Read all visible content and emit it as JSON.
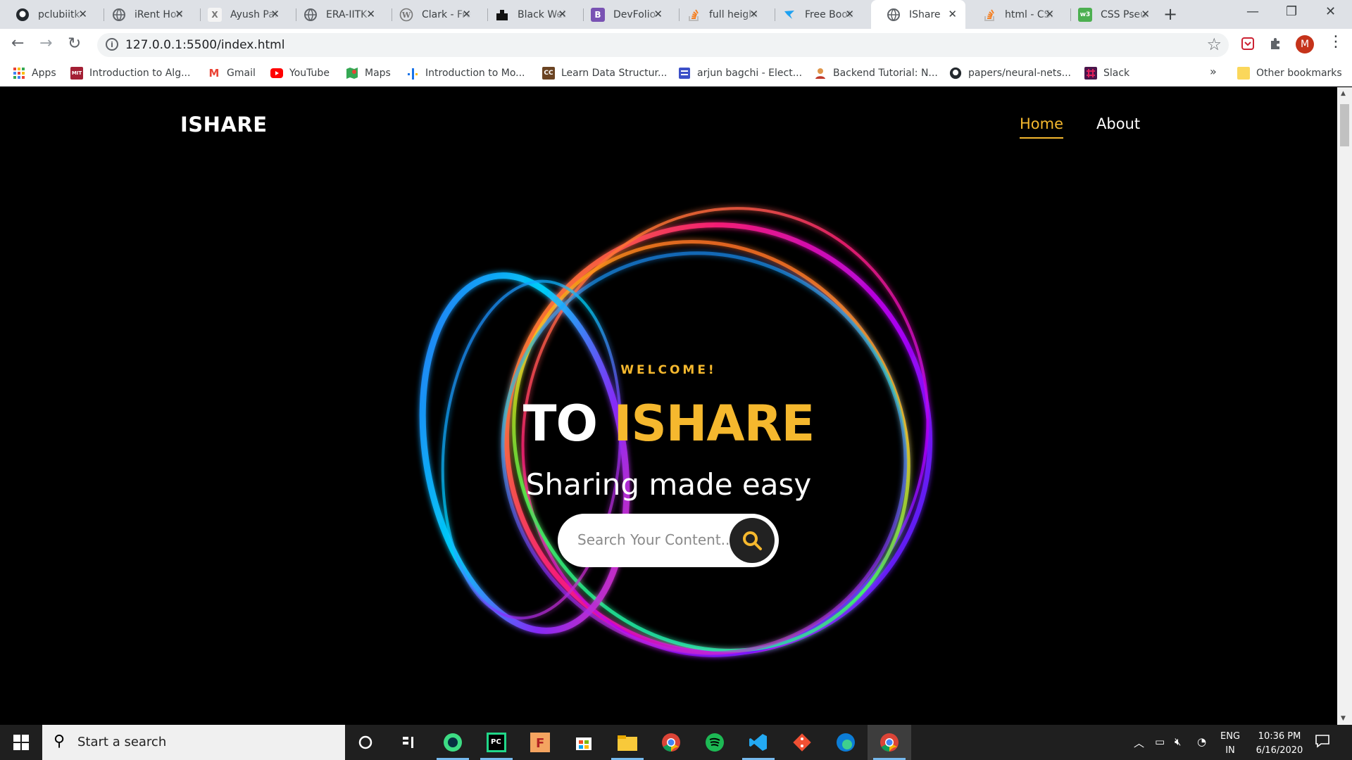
{
  "browser": {
    "tabs": [
      {
        "title": "pclubiitk",
        "icon": "github-icon",
        "active": false
      },
      {
        "title": "iRent Home",
        "icon": "globe-icon",
        "active": false
      },
      {
        "title": "Ayush Pal",
        "icon": "x-logo-icon",
        "active": false
      },
      {
        "title": "ERA-IITK",
        "icon": "globe-icon",
        "active": false
      },
      {
        "title": "Clark - Free",
        "icon": "wordpress-icon",
        "active": false
      },
      {
        "title": "Black Website",
        "icon": "black-logo-icon",
        "active": false
      },
      {
        "title": "DevFolio",
        "icon": "bootstrap-icon",
        "active": false
      },
      {
        "title": "full height",
        "icon": "stackoverflow-icon",
        "active": false
      },
      {
        "title": "Free Bootstrap",
        "icon": "bird-icon",
        "active": false
      },
      {
        "title": "IShare",
        "icon": "globe-icon",
        "active": true
      },
      {
        "title": "html - CSS",
        "icon": "stackoverflow-icon",
        "active": false
      },
      {
        "title": "CSS Pseudo",
        "icon": "w3-icon",
        "active": false
      }
    ],
    "url": "127.0.0.1:5500/index.html",
    "profile_initial": "M",
    "bookmarks": [
      {
        "label": "Apps",
        "icon": "apps-grid-icon"
      },
      {
        "label": "Introduction to Alg...",
        "icon": "mit-ocw-icon"
      },
      {
        "label": "Gmail",
        "icon": "gmail-icon"
      },
      {
        "label": "YouTube",
        "icon": "youtube-icon"
      },
      {
        "label": "Maps",
        "icon": "maps-icon"
      },
      {
        "label": "Introduction to Mo...",
        "icon": "chart-icon"
      },
      {
        "label": "Learn Data Structur...",
        "icon": "cc-icon"
      },
      {
        "label": "arjun bagchi - Elect...",
        "icon": "forms-icon"
      },
      {
        "label": "Backend Tutorial: N...",
        "icon": "person-icon"
      },
      {
        "label": "papers/neural-nets...",
        "icon": "github-icon"
      },
      {
        "label": "Slack",
        "icon": "slack-icon"
      }
    ],
    "bookmarks_overflow": "»",
    "other_bookmarks": "Other bookmarks"
  },
  "page": {
    "brand": "ISHARE",
    "nav": {
      "home": "Home",
      "about": "About"
    },
    "welcome": "WELCOME!",
    "title_prefix": "TO",
    "title_accent": "ISHARE",
    "tagline": "Sharing made easy",
    "search_placeholder": "Search Your Content...",
    "accent_color": "#f5b82e"
  },
  "taskbar": {
    "search_text": "Start a search",
    "apps": [
      "cortana-icon",
      "task-view-icon",
      "android-studio-icon",
      "pycharm-icon",
      "filezilla-icon",
      "store-icon",
      "file-explorer-icon",
      "chrome-icon",
      "spotify-icon",
      "vscode-icon",
      "git-icon",
      "edge-icon",
      "chrome-icon"
    ],
    "lang_top": "ENG",
    "lang_bottom": "IN",
    "time": "10:36 PM",
    "date": "6/16/2020"
  }
}
